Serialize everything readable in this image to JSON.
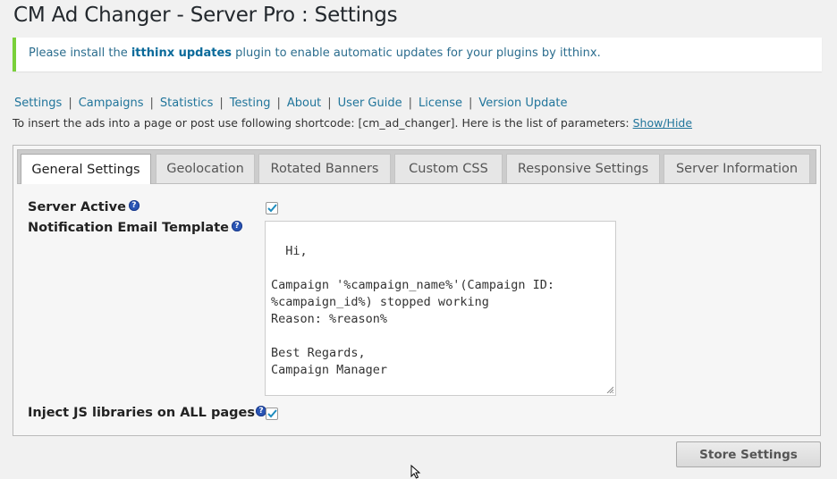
{
  "page": {
    "title": "CM Ad Changer - Server Pro : Settings"
  },
  "notice": {
    "prefix": "Please install the ",
    "link": "itthinx updates",
    "suffix": " plugin to enable automatic updates for your plugins by itthinx."
  },
  "subnav": {
    "items": [
      "Settings",
      "Campaigns",
      "Statistics",
      "Testing",
      "About",
      "User Guide",
      "License",
      "Version Update"
    ]
  },
  "shortcode": {
    "text": "To insert the ads into a page or post use following shortcode: [cm_ad_changer]. Here is the list of parameters: ",
    "toggle": "Show/Hide"
  },
  "tabs": [
    {
      "label": "General Settings",
      "active": true
    },
    {
      "label": "Geolocation"
    },
    {
      "label": "Rotated Banners"
    },
    {
      "label": "Custom CSS"
    },
    {
      "label": "Responsive Settings"
    },
    {
      "label": "Server Information"
    }
  ],
  "settings": {
    "server_active": {
      "label": "Server Active",
      "checked": true
    },
    "notification_email_template": {
      "label": "Notification Email Template",
      "value": "Hi,\n\nCampaign '%campaign_name%'(Campaign ID:\n%campaign_id%) stopped working\nReason: %reason%\n\nBest Regards,\nCampaign Manager"
    },
    "inject_js": {
      "label": "Inject JS libraries on ALL pages",
      "checked": true
    }
  },
  "help_glyph": "?",
  "actions": {
    "store_settings": "Store Settings"
  },
  "colors": {
    "link": "#21759b",
    "notice_border": "#7ad03a",
    "help_icon": "#2a55b5"
  }
}
